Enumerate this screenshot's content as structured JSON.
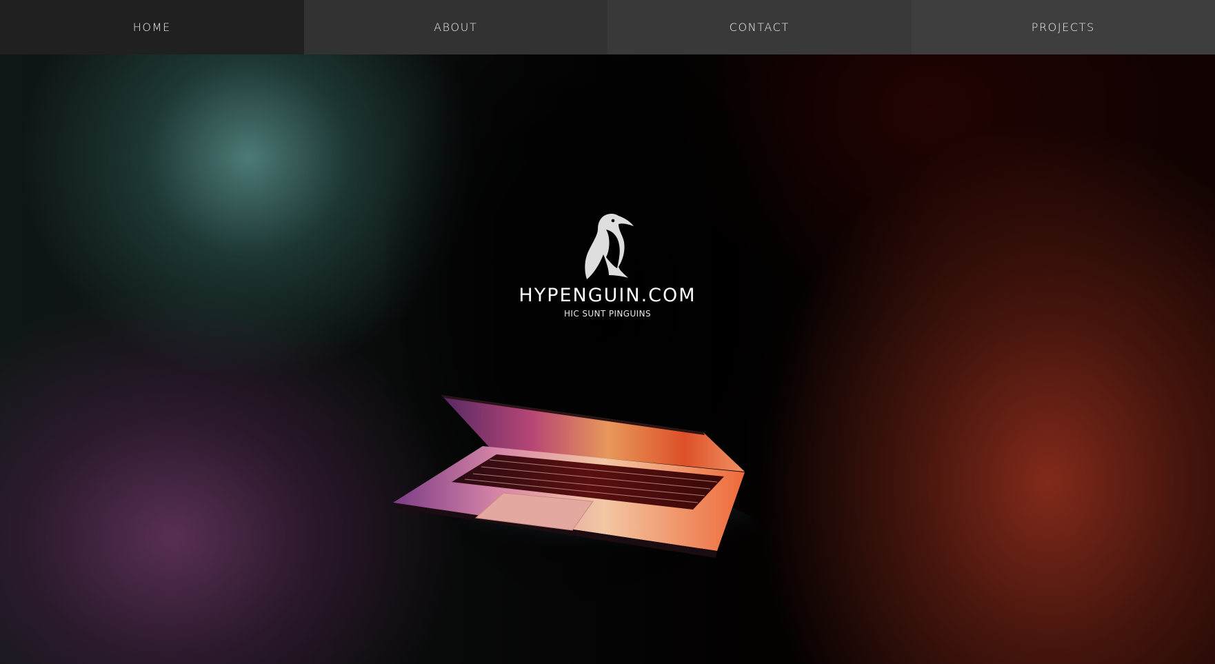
{
  "nav": {
    "items": [
      {
        "label": "HOME"
      },
      {
        "label": "ABOUT"
      },
      {
        "label": "CONTACT"
      },
      {
        "label": "PROJECTS"
      }
    ]
  },
  "hero": {
    "brand": "HYPENGUIN.COM",
    "tagline": "HIC SUNT PINGUINS",
    "logo_icon": "penguin-icon",
    "image": "laptop-illustration"
  },
  "colors": {
    "nav_active": "#202020",
    "nav_bg": "#363636",
    "text": "#ffffff",
    "teal_glow": "#50807a",
    "purple_glow": "#60325a",
    "red_glow": "#882c1c"
  }
}
